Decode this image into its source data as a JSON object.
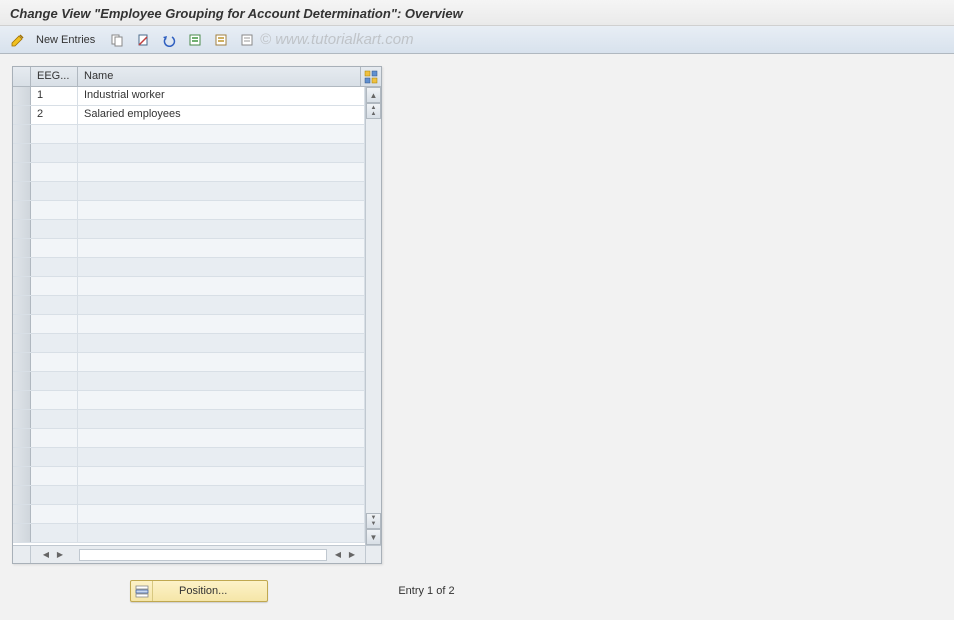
{
  "title": "Change View \"Employee Grouping for Account Determination\": Overview",
  "toolbar": {
    "new_entries_label": "New Entries"
  },
  "watermark": "© www.tutorialkart.com",
  "table": {
    "columns": {
      "eeg": "EEG...",
      "name": "Name"
    },
    "rows": [
      {
        "eeg": "1",
        "name": "Industrial worker",
        "selected": true
      },
      {
        "eeg": "2",
        "name": "Salaried employees",
        "selected": false
      }
    ],
    "empty_row_count": 22
  },
  "footer": {
    "position_label": "Position...",
    "entry_status": "Entry 1 of 2"
  }
}
